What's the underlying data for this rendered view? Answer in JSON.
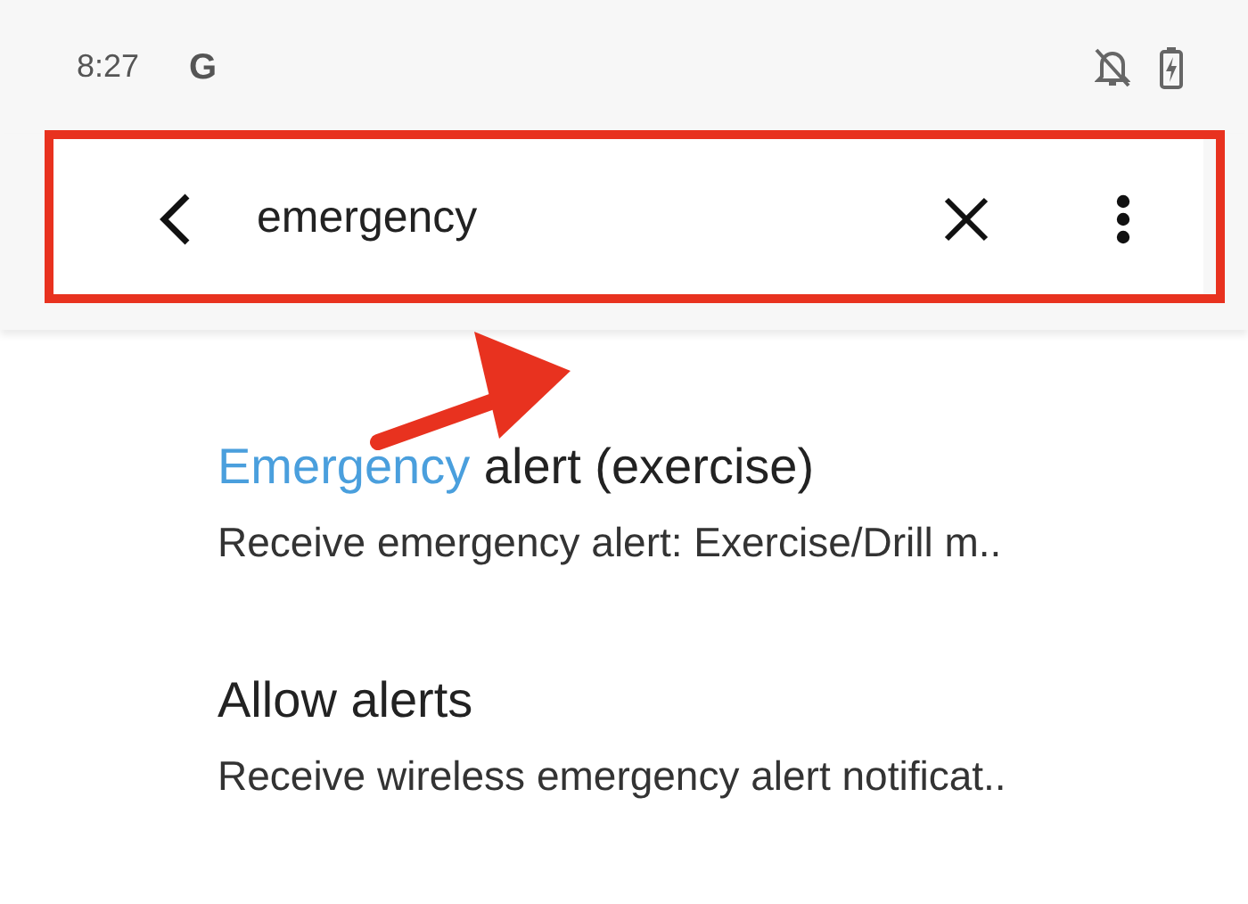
{
  "status_bar": {
    "time": "8:27",
    "app_letter": "G",
    "notifications_muted": true,
    "battery_charging": true
  },
  "search": {
    "value": "emergency"
  },
  "results": [
    {
      "title_match": "Emergency",
      "title_rest": " alert (exercise)",
      "summary": "Receive emergency alert: Exercise/Drill m.."
    },
    {
      "title_rest": "Allow alerts",
      "summary": "Receive wireless emergency alert notificat.."
    }
  ],
  "annotations": {
    "highlight_frame": true,
    "arrow": true
  }
}
